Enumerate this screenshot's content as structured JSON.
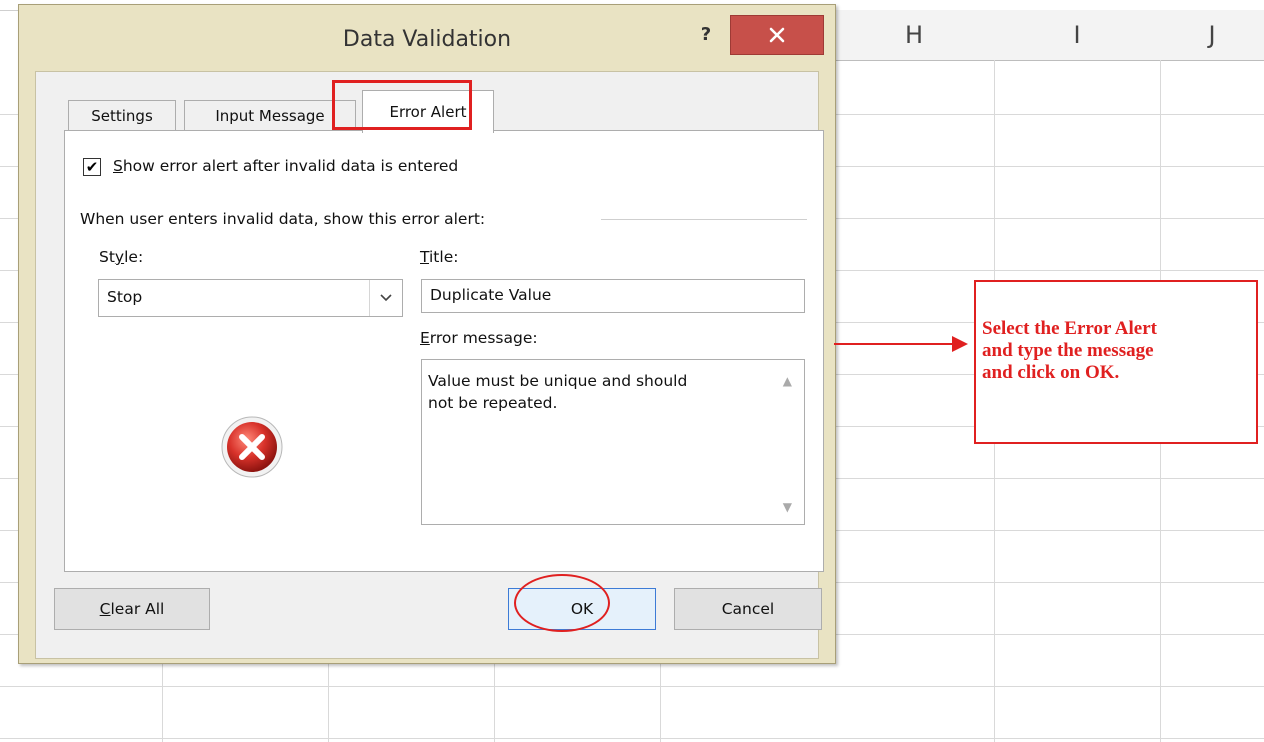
{
  "spreadsheet": {
    "column_headers": [
      "H",
      "I",
      "J"
    ]
  },
  "dialog": {
    "title": "Data Validation",
    "help_glyph": "?",
    "close_glyph": "✕",
    "tabs": [
      {
        "label": "Settings",
        "selected": false
      },
      {
        "label": "Input Message",
        "selected": false
      },
      {
        "label": "Error Alert",
        "selected": true
      }
    ],
    "show_alert": {
      "checked": true,
      "label_prefix": "",
      "label_mnemonic": "S",
      "label_rest": "how error alert after invalid data is entered"
    },
    "group_label": "When user enters invalid data, show this error alert:",
    "style": {
      "label_a": "St",
      "label_mnemonic": "y",
      "label_b": "le:",
      "value": "Stop",
      "icon": "stop-error-icon"
    },
    "title_field": {
      "label_mnemonic": "T",
      "label_rest": "itle:",
      "value": "Duplicate Value"
    },
    "error_message": {
      "label_mnemonic": "E",
      "label_rest": "rror message:",
      "value": "Value must be unique and should\nnot be repeated."
    },
    "buttons": {
      "clear_mnemonic": "C",
      "clear_rest": "lear All",
      "ok": "OK",
      "cancel": "Cancel"
    }
  },
  "annotation": {
    "note": "Select the Error Alert\nand type the message\nand click on OK.",
    "color": "#e02020"
  }
}
